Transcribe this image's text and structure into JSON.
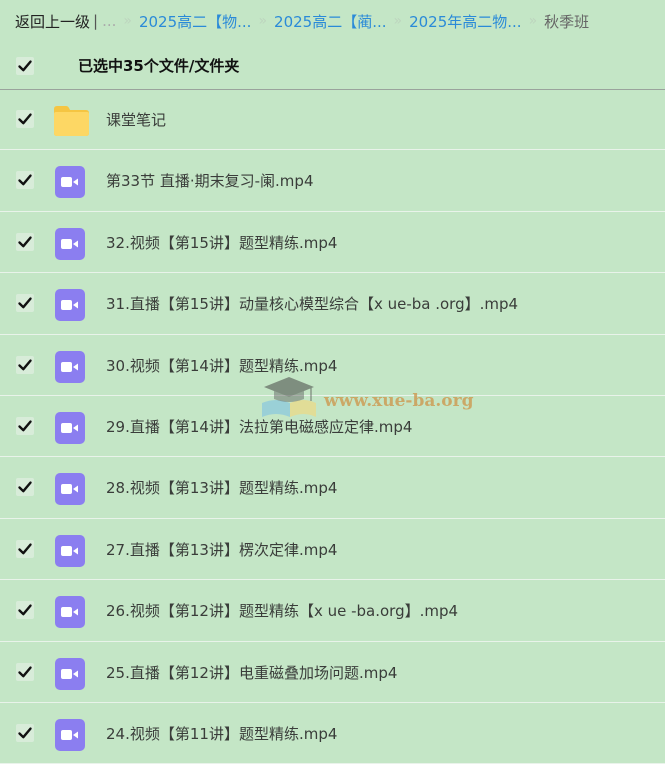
{
  "breadcrumb": {
    "back_label": "返回上一级",
    "separator": "|",
    "ellipsis": "...",
    "arrow_glyph": "»",
    "links": [
      "2025高二【物...",
      "2025高二【蔺...",
      "2025年高二物..."
    ],
    "current": "秋季班"
  },
  "selection": {
    "checked": true,
    "label": "已选中35个文件/文件夹"
  },
  "files": [
    {
      "type": "folder",
      "icon": "folder-icon",
      "name": "课堂笔记",
      "checked": true
    },
    {
      "type": "video",
      "icon": "video-icon",
      "name": "第33节 直播·期末复习-阑.mp4",
      "checked": true
    },
    {
      "type": "video",
      "icon": "video-icon",
      "name": "32.视频【第15讲】题型精练.mp4",
      "checked": true
    },
    {
      "type": "video",
      "icon": "video-icon",
      "name": "31.直播【第15讲】动量核心模型综合【x ue-ba .org】.mp4",
      "checked": true
    },
    {
      "type": "video",
      "icon": "video-icon",
      "name": "30.视频【第14讲】题型精练.mp4",
      "checked": true
    },
    {
      "type": "video",
      "icon": "video-icon",
      "name": "29.直播【第14讲】法拉第电磁感应定律.mp4",
      "checked": true
    },
    {
      "type": "video",
      "icon": "video-icon",
      "name": "28.视频【第13讲】题型精练.mp4",
      "checked": true
    },
    {
      "type": "video",
      "icon": "video-icon",
      "name": "27.直播【第13讲】楞次定律.mp4",
      "checked": true
    },
    {
      "type": "video",
      "icon": "video-icon",
      "name": "26.视频【第12讲】题型精练【x ue -ba.org】.mp4",
      "checked": true
    },
    {
      "type": "video",
      "icon": "video-icon",
      "name": "25.直播【第12讲】电重磁叠加场问题.mp4",
      "checked": true
    },
    {
      "type": "video",
      "icon": "video-icon",
      "name": "24.视频【第11讲】题型精练.mp4",
      "checked": true
    }
  ],
  "watermark": {
    "text": "www.xue-ba.org"
  },
  "colors": {
    "background": "#c4e6c6",
    "link": "#2a8ad8",
    "video_icon": "#8b7ef0",
    "folder_icon": "#fdd764",
    "watermark": "#cd964b"
  }
}
